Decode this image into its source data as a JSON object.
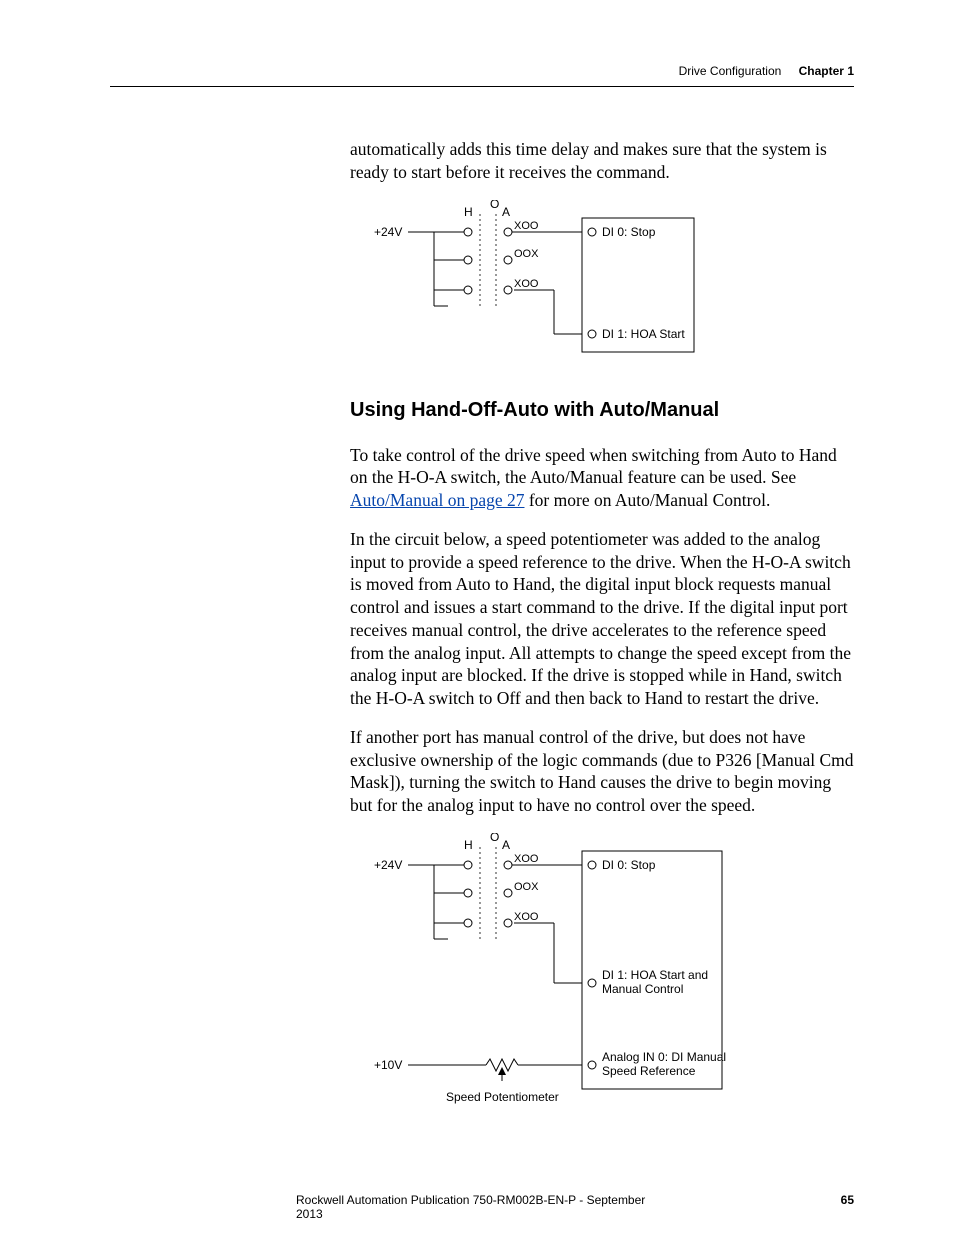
{
  "header": {
    "section": "Drive Configuration",
    "chapter": "Chapter 1"
  },
  "intro_para": "automatically adds this time delay and makes sure that the system is ready to start before it receives the command.",
  "diagram1": {
    "supply": "+24V",
    "H": "H",
    "O": "O",
    "A": "A",
    "row1": "XOO",
    "row2": "OOX",
    "row3": "XOO",
    "di0": "DI 0: Stop",
    "di1": "DI 1: HOA Start"
  },
  "section_title": "Using Hand-Off-Auto with Auto/Manual",
  "para1_a": "To take control of the drive speed when switching from Auto to Hand on the H-O-A switch, the Auto/Manual feature can be used. See ",
  "para1_link": "Auto/Manual on page 27",
  "para1_b": " for more on Auto/Manual Control.",
  "para2": "In the circuit below, a speed potentiometer was added to the analog input to provide a speed reference to the drive. When the H-O-A switch is moved from Auto to Hand, the digital input block requests manual control and issues a start command to the drive. If the digital input port receives manual control, the drive accelerates to the reference speed from the analog input. All attempts to change the speed except from the analog input are blocked. If the drive is stopped while in Hand, switch the H-O-A switch to Off and then back to Hand to restart the drive.",
  "para3": "If another port has manual control of the drive, but does not have exclusive ownership of the logic commands (due to P326 [Manual Cmd Mask]), turning the switch to Hand causes the drive to begin moving but for the analog input to have no control over the speed.",
  "diagram2": {
    "supply": "+24V",
    "supply2": "+10V",
    "H": "H",
    "O": "O",
    "A": "A",
    "row1": "XOO",
    "row2": "OOX",
    "row3": "XOO",
    "di0": "DI 0: Stop",
    "di1a": "DI 1: HOA Start and",
    "di1b": "Manual Control",
    "ai0a": "Analog IN 0: DI Manual",
    "ai0b": "Speed Reference",
    "pot": "Speed Potentiometer"
  },
  "footer": {
    "publication": "Rockwell Automation Publication 750-RM002B-EN-P - September 2013",
    "page": "65"
  }
}
